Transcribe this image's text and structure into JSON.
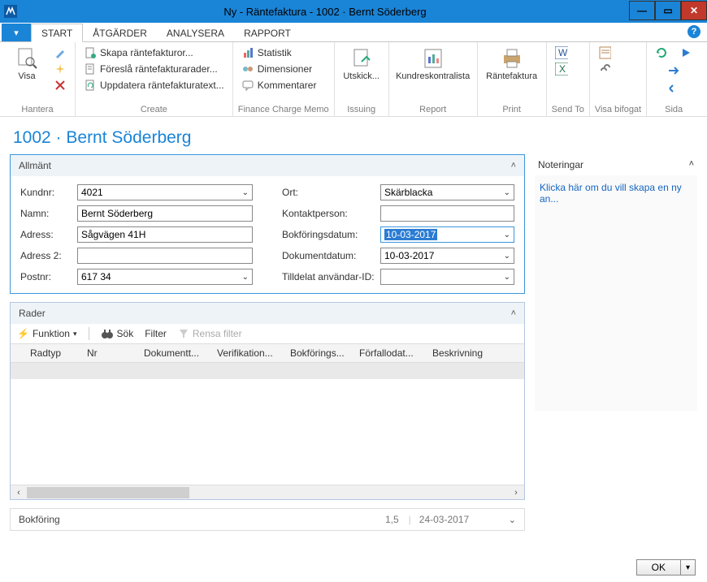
{
  "window": {
    "title": "Ny - Räntefaktura - 1002 · Bernt Söderberg"
  },
  "tabs": {
    "file_dd": "▾",
    "start": "START",
    "atgarder": "ÅTGÄRDER",
    "analysera": "ANALYSERA",
    "rapport": "RAPPORT"
  },
  "ribbon": {
    "hantera": {
      "label": "Hantera",
      "visa": "Visa"
    },
    "create": {
      "label": "Create",
      "skapa": "Skapa räntefakturor...",
      "foresla": "Föreslå räntefakturarader...",
      "uppdatera": "Uppdatera räntefakturatext..."
    },
    "memo": {
      "label": "Finance Charge Memo",
      "statistik": "Statistik",
      "dimensioner": "Dimensioner",
      "kommentarer": "Kommentarer"
    },
    "issuing": {
      "label": "Issuing",
      "utskick": "Utskick..."
    },
    "report": {
      "label": "Report",
      "kund": "Kundreskontralista"
    },
    "print": {
      "label": "Print",
      "rf": "Räntefaktura"
    },
    "sendto": {
      "label": "Send To"
    },
    "visab": {
      "label": "Visa bifogat"
    },
    "sida": {
      "label": "Sida"
    }
  },
  "page": {
    "heading": "1002 · Bernt Söderberg"
  },
  "allmant": {
    "title": "Allmänt",
    "labels": {
      "kundnr": "Kundnr:",
      "namn": "Namn:",
      "adress": "Adress:",
      "adress2": "Adress 2:",
      "postnr": "Postnr:",
      "ort": "Ort:",
      "kontakt": "Kontaktperson:",
      "bokdatum": "Bokföringsdatum:",
      "dokdatum": "Dokumentdatum:",
      "tilldelat": "Tilldelat användar-ID:"
    },
    "values": {
      "kundnr": "4021",
      "namn": "Bernt Söderberg",
      "adress": "Sågvägen 41H",
      "adress2": "",
      "postnr": "617 34",
      "ort": "Skärblacka",
      "kontakt": "",
      "bokdatum": "10-03-2017",
      "dokdatum": "10-03-2017",
      "tilldelat": ""
    }
  },
  "rader": {
    "title": "Rader",
    "toolbar": {
      "funktion": "Funktion",
      "sok": "Sök",
      "filter": "Filter",
      "rensa": "Rensa filter"
    },
    "cols": {
      "radtyp": "Radtyp",
      "nr": "Nr",
      "dokument": "Dokumentt...",
      "verifik": "Verifikation...",
      "bokf": "Bokförings...",
      "forfallo": "Förfallodat...",
      "beskr": "Beskrivning"
    }
  },
  "bokforing": {
    "title": "Bokföring",
    "v1": "1,5",
    "v2": "24-03-2017"
  },
  "notes": {
    "title": "Noteringar",
    "link": "Klicka här om du vill skapa en ny an..."
  },
  "buttons": {
    "ok": "OK"
  }
}
